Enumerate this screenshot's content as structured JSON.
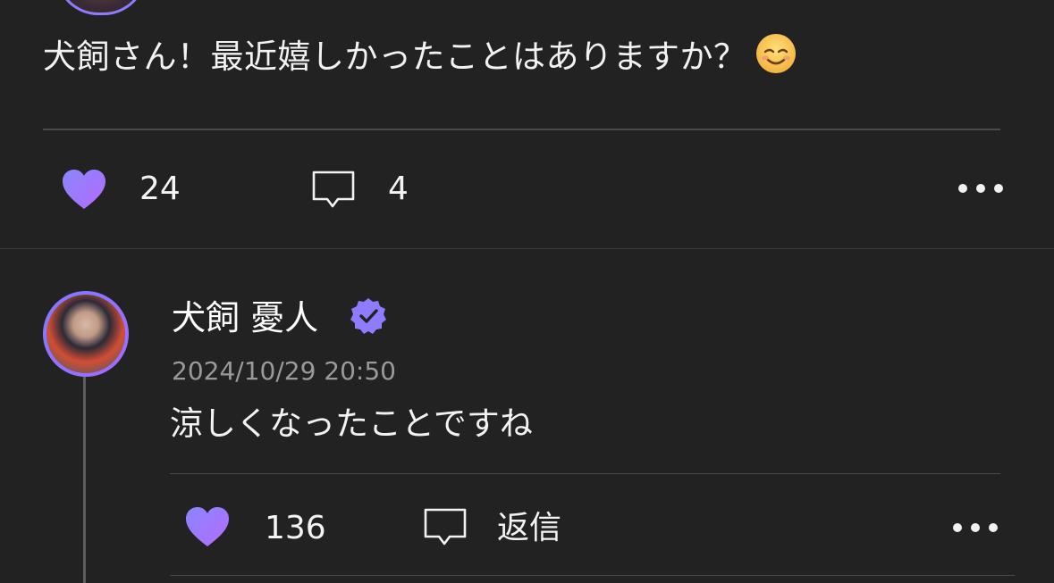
{
  "post": {
    "text": "犬飼さん！最近嬉しかったことはありますか？",
    "emoji_icon": "smiling-face-emoji",
    "like_count": "24",
    "comment_count": "4"
  },
  "reply": {
    "author_name": "犬飼 憂人",
    "verified_icon": "verified-badge-icon",
    "timestamp": "2024/10/29 20:50",
    "text": "涼しくなったことですね",
    "like_count": "136",
    "reply_label": "返信"
  },
  "colors": {
    "background": "#222223",
    "heart_gradient_start": "#8a86ff",
    "heart_gradient_end": "#b46bff",
    "badge": "#8f7bff"
  }
}
